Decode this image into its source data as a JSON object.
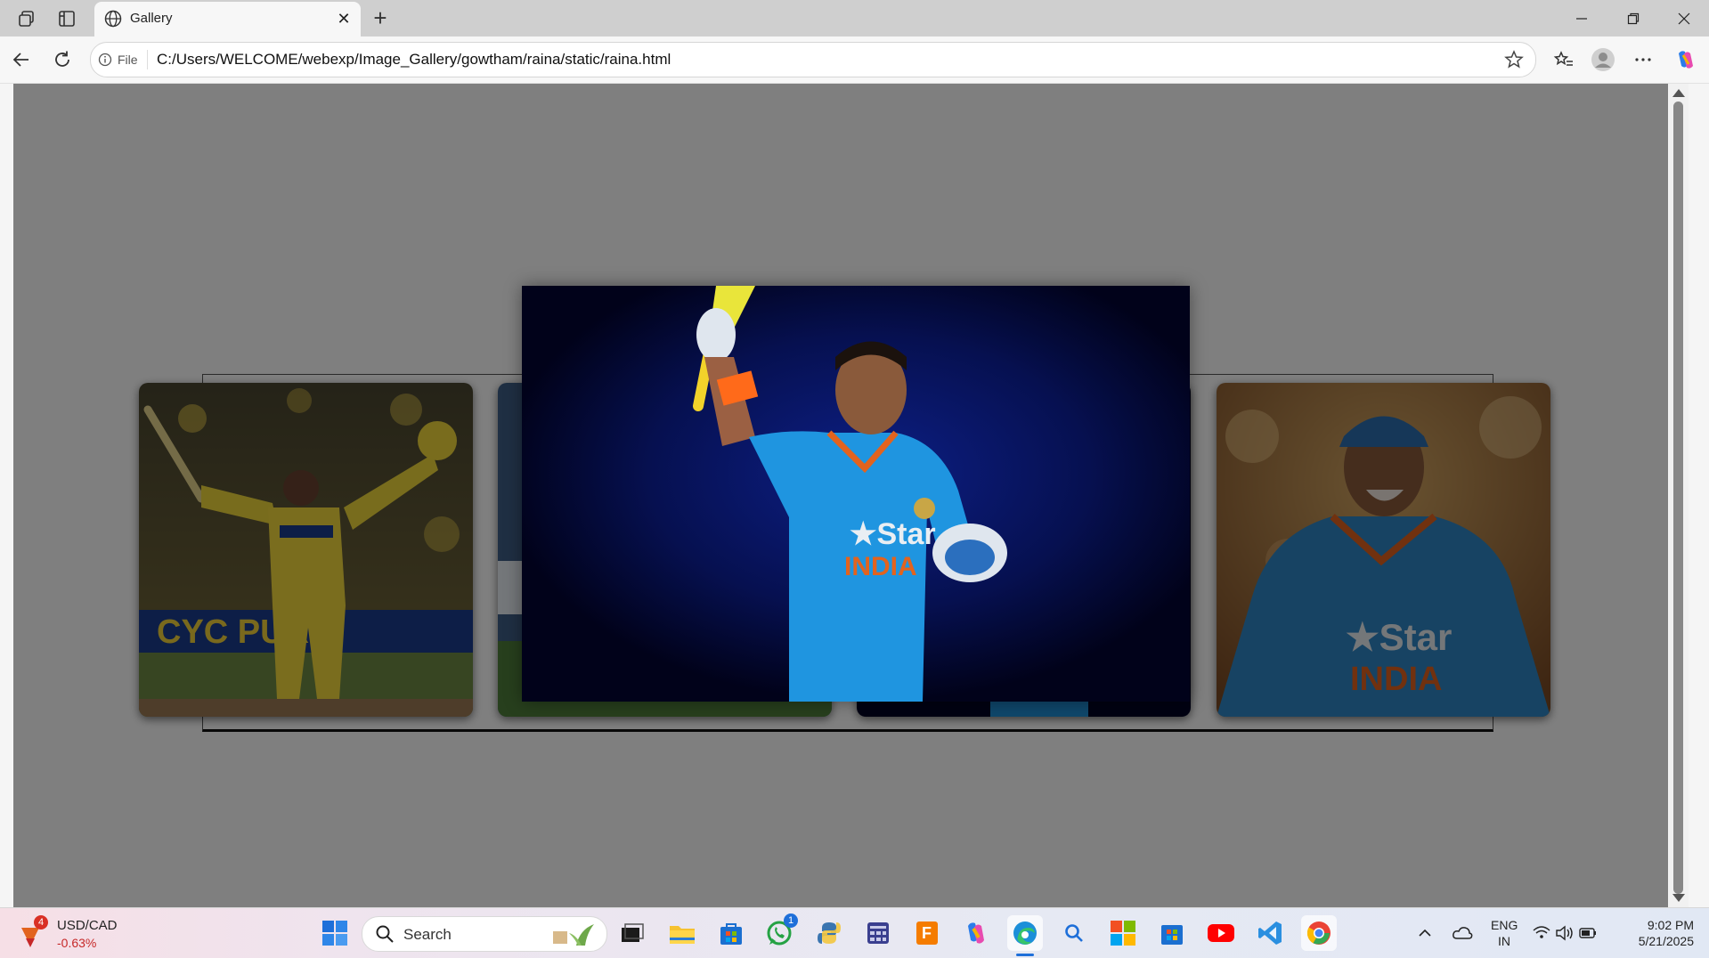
{
  "browser": {
    "tab_title": "Gallery",
    "address_label": "File",
    "url": "C:/Users/WELCOME/webexp/Image_Gallery/gowtham/raina/static/raina.html"
  },
  "gallery": {
    "thumbnails": [
      {
        "alt": "Raina in yellow CSK kit raising bat and helmet"
      },
      {
        "alt": "Raina in India kit celebrating"
      },
      {
        "alt": "Raina in India kit raising bat"
      },
      {
        "alt": "Raina in India kit smiling"
      }
    ],
    "lightbox": {
      "alt": "Raina in blue India kit raising bat against dark background"
    }
  },
  "taskbar": {
    "weather_badge": "4",
    "ticker": "USD/CAD",
    "ticker_change": "-0.63%",
    "search_label": "Search",
    "whatsapp_badge": "1",
    "language": "ENG",
    "region": "IN",
    "time": "9:02 PM",
    "date": "5/21/2025"
  },
  "colors": {
    "overlay": "#7f7f7f",
    "lightbox_bg": "#02031a",
    "negative": "#c62828"
  }
}
